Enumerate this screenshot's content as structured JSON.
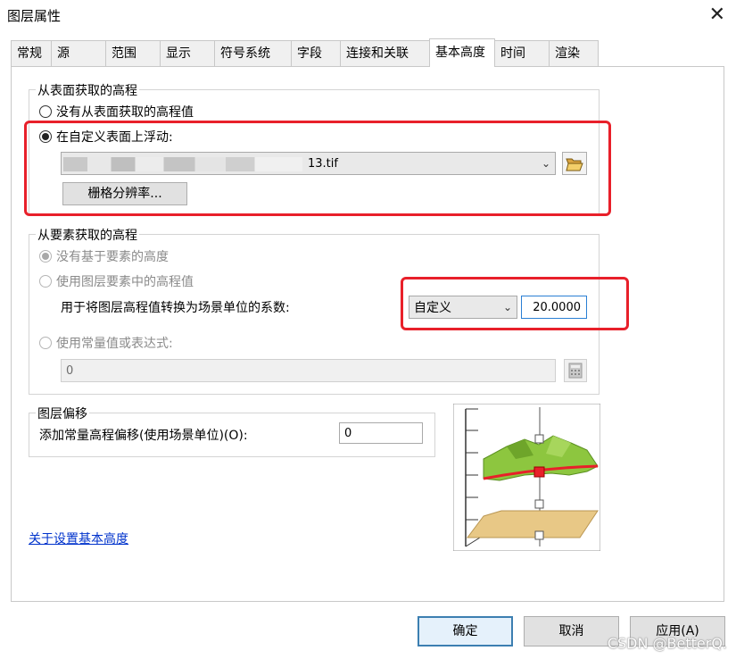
{
  "window": {
    "title": "图层属性",
    "close_glyph": "✕"
  },
  "tabs": [
    {
      "label": "常规"
    },
    {
      "label": "源"
    },
    {
      "label": "范围"
    },
    {
      "label": "显示"
    },
    {
      "label": "符号系统"
    },
    {
      "label": "字段"
    },
    {
      "label": "连接和关联"
    },
    {
      "label": "基本高度",
      "active": true
    },
    {
      "label": "时间"
    },
    {
      "label": "渲染"
    }
  ],
  "surface_group": {
    "title": "从表面获取的高程",
    "option_none": "没有从表面获取的高程值",
    "option_custom": "在自定义表面上浮动:",
    "surface_file": "13.tif",
    "raster_res_button": "栅格分辨率..."
  },
  "feature_group": {
    "title": "从要素获取的高程",
    "option_none": "没有基于要素的高度",
    "option_layer": "使用图层要素中的高程值",
    "factor_label": "用于将图层高程值转换为场景单位的系数:",
    "factor_unit": "自定义",
    "factor_value": "20.0000",
    "option_expr": "使用常量值或表达式:",
    "expr_value": "0"
  },
  "offset_group": {
    "title": "图层偏移",
    "label": "添加常量高程偏移(使用场景单位)(O):",
    "value": "0"
  },
  "help_link": "关于设置基本高度",
  "buttons": {
    "ok": "确定",
    "cancel": "取消",
    "apply": "应用(A)"
  },
  "watermark": "CSDN @BetterQ.",
  "colors": {
    "highlight": "#e8202a",
    "terrain": "#8dc63f",
    "base": "#e8c886"
  }
}
